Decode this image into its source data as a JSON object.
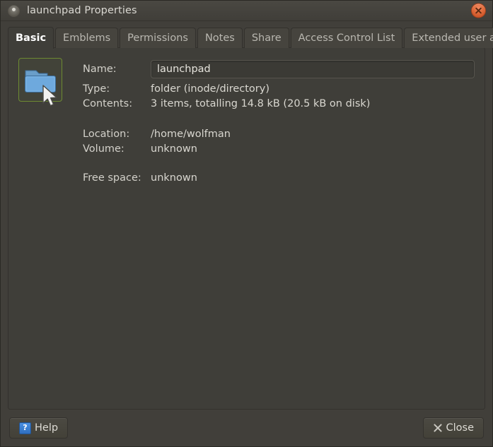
{
  "window": {
    "title": "launchpad Properties",
    "title_icon": "disc-icon",
    "close_icon": "close-icon"
  },
  "tabs": [
    {
      "label": "Basic",
      "active": true
    },
    {
      "label": "Emblems",
      "active": false
    },
    {
      "label": "Permissions",
      "active": false
    },
    {
      "label": "Notes",
      "active": false
    },
    {
      "label": "Share",
      "active": false
    },
    {
      "label": "Access Control List",
      "active": false
    },
    {
      "label": "Extended user attributes",
      "active": false
    }
  ],
  "basic": {
    "icon": "folder-icon",
    "name_label": "Name:",
    "name_value": "launchpad",
    "type_label": "Type:",
    "type_value": "folder (inode/directory)",
    "contents_label": "Contents:",
    "contents_value": "3 items, totalling 14.8 kB (20.5 kB on disk)",
    "location_label": "Location:",
    "location_value": "/home/wolfman",
    "volume_label": "Volume:",
    "volume_value": "unknown",
    "free_space_label": "Free space:",
    "free_space_value": "unknown"
  },
  "actions": {
    "help_label": "Help",
    "help_icon": "question-mark-icon",
    "close_label": "Close",
    "close_icon": "x-icon"
  },
  "colors": {
    "window_bg": "#413f3a",
    "page_bg": "#3f3e39",
    "tab_inactive_bg": "#46443e",
    "text": "#d9d7d0",
    "active_tab_text": "#ffffff",
    "close_button": "#e06a3a",
    "selection_border": "#6d8a32",
    "folder_blue": "#5b9bd5",
    "help_icon_blue": "#2f6fc0"
  }
}
